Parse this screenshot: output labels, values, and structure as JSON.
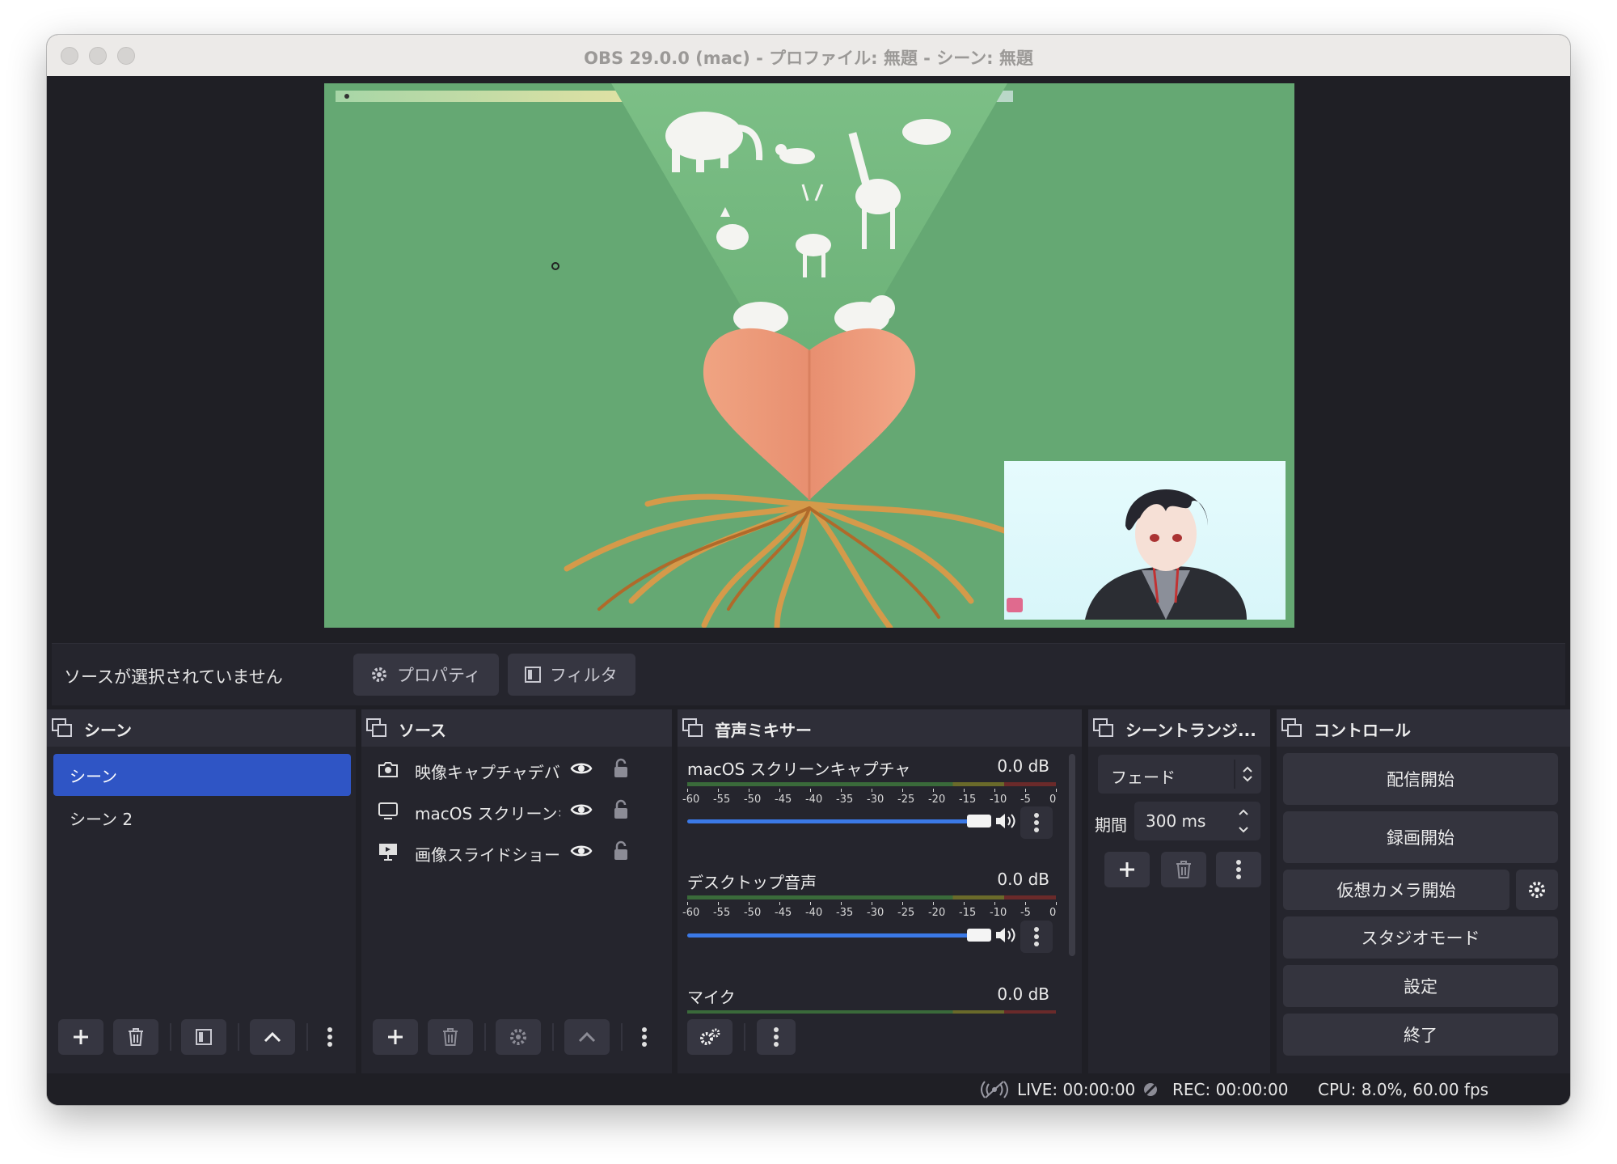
{
  "window": {
    "title": "OBS 29.0.0 (mac) - プロファイル: 無題 - シーン: 無題"
  },
  "toolbar": {
    "no_source_text": "ソースが選択されていません",
    "properties_label": "プロパティ",
    "filters_label": "フィルタ"
  },
  "scenes": {
    "title": "シーン",
    "items": [
      {
        "label": "シーン",
        "selected": true
      },
      {
        "label": "シーン 2",
        "selected": false
      }
    ]
  },
  "sources": {
    "title": "ソース",
    "items": [
      {
        "label": "映像キャプチャデバイス",
        "icon": "camera-icon"
      },
      {
        "label": "macOS スクリーンキャプチャ",
        "icon": "monitor-icon"
      },
      {
        "label": "画像スライドショー",
        "icon": "slideshow-icon"
      }
    ]
  },
  "mixer": {
    "title": "音声ミキサー",
    "tick_labels": [
      "-60",
      "-55",
      "-50",
      "-45",
      "-40",
      "-35",
      "-30",
      "-25",
      "-20",
      "-15",
      "-10",
      "-5",
      "0"
    ],
    "channels": [
      {
        "name": "macOS スクリーンキャプチャ",
        "db": "0.0 dB",
        "volume": 1.0
      },
      {
        "name": "デスクトップ音声",
        "db": "0.0 dB",
        "volume": 1.0
      },
      {
        "name": "マイク",
        "db": "0.0 dB",
        "volume": 1.0
      }
    ]
  },
  "transitions": {
    "title": "シーントランジ...",
    "selected": "フェード",
    "duration_label": "期間",
    "duration_value": "300 ms"
  },
  "controls": {
    "title": "コントロール",
    "start_streaming": "配信開始",
    "start_recording": "録画開始",
    "start_virtual_camera": "仮想カメラ開始",
    "studio_mode": "スタジオモード",
    "settings": "設定",
    "exit": "終了"
  },
  "status": {
    "live": "LIVE: 00:00:00",
    "rec": "REC: 00:00:00",
    "cpu": "CPU: 8.0%, 60.00 fps"
  },
  "colors": {
    "accent": "#2f55c5",
    "panel": "#25252d",
    "background": "#1f1f25",
    "preview_green": "#6cae7a"
  }
}
